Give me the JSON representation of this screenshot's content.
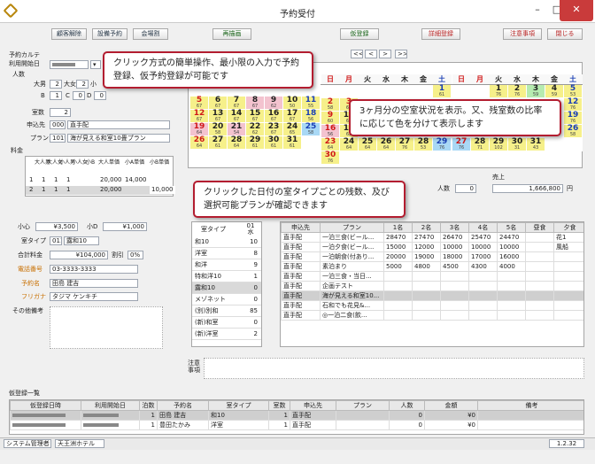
{
  "window": {
    "title": "予約受付",
    "min": "–",
    "max": "□",
    "close": "✕"
  },
  "toolbar": {
    "b1": "顧客解除",
    "b2": "設備予約",
    "b3": "会場割",
    "b4": "再描画",
    "b5": "仮登録",
    "b6": "詳細登録",
    "b7": "注意事項",
    "b8": "閉じる"
  },
  "left": {
    "section_karte": "予約カルテ",
    "use_date_label": "利用開始日",
    "ninzu_label": "人数",
    "adult_label": "大男",
    "adult_val": "2",
    "adult_f_label": "大女",
    "adult_f_val": "2",
    "child_label": "小",
    "b_label": "B",
    "b_val": "1",
    "c_label": "C",
    "c_val": "0",
    "d_label": "D",
    "d_val": "0",
    "rooms_label": "室数",
    "rooms_val": "2",
    "applicant_label": "申込先",
    "applicant_code": "000",
    "applicant_name": "直手配",
    "plan_label": "プラン",
    "plan_code": "1019",
    "plan_name": "海が見える和室10畳プラン",
    "fee_label": "料金",
    "fee_headers": [
      "大人男",
      "大人女",
      "小人男",
      "小人女",
      "小B",
      "大人単価",
      "小A単価",
      "小B単価"
    ],
    "fee_rows": [
      [
        "1",
        "1",
        "1",
        "1",
        "",
        "20,000",
        "14,000",
        ""
      ],
      [
        "2",
        "1",
        "1",
        "1",
        "",
        "20,000",
        "",
        "10,000"
      ]
    ],
    "shokei_label": "小心",
    "shokei_val": "¥3,500",
    "shoD_label": "小D",
    "shoD_val": "¥1,000",
    "roomtype_label": "室タイプ",
    "roomtype_code": "011",
    "roomtype_name": "露和10",
    "total_label": "合計料金",
    "total_val": "¥104,000",
    "discount_label": "割引",
    "discount_val": "0%",
    "tel_label": "電話番号",
    "tel_val": "03-3333-3333",
    "name_label": "予約名",
    "name_val": "田島 建吉",
    "kana_label": "フリガナ",
    "kana_val": "タジマ ケンキチ",
    "other_label": "その他備考"
  },
  "calendar": {
    "nav": [
      "<<",
      "<",
      ">",
      ">>"
    ],
    "weekdays": [
      "日",
      "月",
      "火",
      "水",
      "木",
      "金",
      "土"
    ]
  },
  "callouts": {
    "c1": "クリック方式の簡単操作、最小限の入力で予約登録、仮予約登録が可能です",
    "c2": "3ヶ月分の空室状況を表示。又、残室数の比率に応じて色を分けて表示します",
    "c3": "クリックした日付の室タイプごとの残数、及び選択可能プランが確認できます"
  },
  "midstats": {
    "ninzu_label": "人数",
    "ninzu_val": "0",
    "sales_label": "売上",
    "sales_val": "1,666,800",
    "yen": "円"
  },
  "roomtypes": {
    "header": [
      "室タイプ",
      "01 水"
    ],
    "rows": [
      [
        "和10",
        "10"
      ],
      [
        "洋室",
        "8"
      ],
      [
        "和洋",
        "9"
      ],
      [
        "特和洋10",
        "1"
      ],
      [
        "露和10",
        "0"
      ],
      [
        "メゾネット",
        "0"
      ],
      [
        "(別)別和",
        "85"
      ],
      [
        "(新)和室",
        "0"
      ],
      [
        "(新)洋室",
        "2"
      ]
    ]
  },
  "plans": {
    "headers": [
      "申込先",
      "プラン",
      "1名",
      "2名",
      "3名",
      "4名",
      "5名",
      "昼食",
      "夕食"
    ],
    "rows": [
      [
        "直手配",
        "一泊三食(ビール...",
        "28470",
        "27470",
        "26470",
        "25470",
        "24470",
        "",
        "花1"
      ],
      [
        "直手配",
        "一泊夕食(ビール...",
        "15000",
        "12000",
        "10000",
        "10000",
        "10000",
        "",
        "風船"
      ],
      [
        "直手配",
        "一泊朝食(付あり...",
        "20000",
        "19000",
        "18000",
        "17000",
        "16000",
        "",
        ""
      ],
      [
        "直手配",
        "素泊まり",
        "5000",
        "4800",
        "4500",
        "4300",
        "4000",
        "",
        ""
      ],
      [
        "直手配",
        "一泊三食・当日...",
        "",
        "",
        "",
        "",
        "",
        "",
        ""
      ],
      [
        "直手配",
        "企画テスト",
        "",
        "",
        "",
        "",
        "",
        "",
        ""
      ],
      [
        "直手配",
        "海が見える和室10...",
        "",
        "",
        "",
        "",
        "",
        "",
        ""
      ],
      [
        "直手配",
        "石和でも花見&...",
        "",
        "",
        "",
        "",
        "",
        "",
        ""
      ],
      [
        "直手配",
        "◎一泊二食(飲...",
        "",
        "",
        "",
        "",
        "",
        "",
        ""
      ]
    ]
  },
  "note_label": "注意事項",
  "kari": {
    "title": "仮登録一覧",
    "headers": [
      "仮登録日時",
      "利用開始日",
      "泊数",
      "予約名",
      "室タイプ",
      "室数",
      "申込先",
      "プラン",
      "人数",
      "金額",
      "備考"
    ],
    "rows": [
      [
        "",
        "",
        "1",
        "田島 建吉",
        "和10",
        "1",
        "直手配",
        "",
        "0",
        "¥0",
        ""
      ],
      [
        "",
        "",
        "1",
        "豊田たかみ",
        "洋室",
        "1",
        "直手配",
        "",
        "0",
        "¥0",
        ""
      ]
    ]
  },
  "status": {
    "user": "システム管理者",
    "hotel": "天王洲ホテル",
    "version": "1.2.32"
  }
}
